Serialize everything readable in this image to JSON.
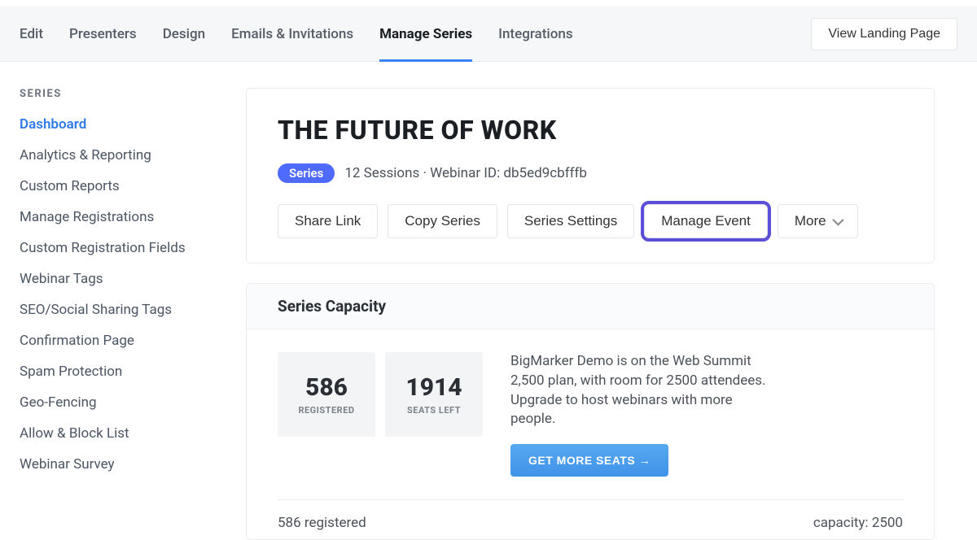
{
  "topnav": {
    "tabs": [
      {
        "label": "Edit",
        "active": false
      },
      {
        "label": "Presenters",
        "active": false
      },
      {
        "label": "Design",
        "active": false
      },
      {
        "label": "Emails & Invitations",
        "active": false
      },
      {
        "label": "Manage Series",
        "active": true
      },
      {
        "label": "Integrations",
        "active": false
      }
    ],
    "view_landing_label": "View Landing Page"
  },
  "sidebar": {
    "heading": "SERIES",
    "items": [
      {
        "label": "Dashboard",
        "active": true
      },
      {
        "label": "Analytics & Reporting",
        "active": false
      },
      {
        "label": "Custom Reports",
        "active": false
      },
      {
        "label": "Manage Registrations",
        "active": false
      },
      {
        "label": "Custom Registration Fields",
        "active": false
      },
      {
        "label": "Webinar Tags",
        "active": false
      },
      {
        "label": "SEO/Social Sharing Tags",
        "active": false
      },
      {
        "label": "Confirmation Page",
        "active": false
      },
      {
        "label": "Spam Protection",
        "active": false
      },
      {
        "label": "Geo-Fencing",
        "active": false
      },
      {
        "label": "Allow & Block List",
        "active": false
      },
      {
        "label": "Webinar Survey",
        "active": false
      }
    ]
  },
  "header": {
    "title": "THE FUTURE OF WORK",
    "pill": "Series",
    "meta": "12 Sessions · Webinar ID: db5ed9cbfffb",
    "actions": {
      "share": "Share Link",
      "copy": "Copy Series",
      "settings": "Series Settings",
      "manage_event": "Manage Event",
      "more": "More"
    }
  },
  "capacity": {
    "heading": "Series Capacity",
    "registered_value": "586",
    "registered_label": "REGISTERED",
    "seats_left_value": "1914",
    "seats_left_label": "SEATS LEFT",
    "description": "BigMarker Demo is on the Web Summit 2,500 plan, with room for 2500 attendees. Upgrade to host webinars with more people.",
    "get_seats_label": "GET MORE SEATS →",
    "footer_registered": "586 registered",
    "footer_capacity": "capacity: 2500"
  }
}
